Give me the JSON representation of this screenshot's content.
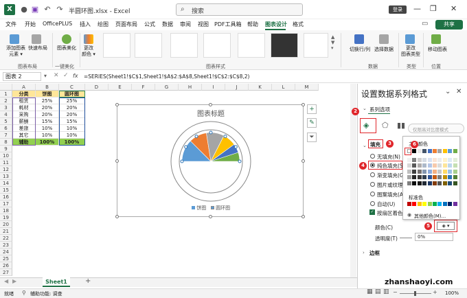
{
  "titlebar": {
    "filename": "半圆环图.xlsx - Excel",
    "search_placeholder": "搜索",
    "login": "登录"
  },
  "menu": {
    "items": [
      "文件",
      "开始",
      "OfficePLUS",
      "插入",
      "绘图",
      "页面布局",
      "公式",
      "数据",
      "审阅",
      "视图",
      "PDF工具箱",
      "帮助",
      "图表设计",
      "格式"
    ],
    "active": "图表设计",
    "share": "共享"
  },
  "ribbon": {
    "add_element": "添加图表\n元素",
    "quick_layout": "快速布局",
    "beautify": "图表美化",
    "change_color": "更改\n颜色",
    "switch_rowcol": "切换行/列",
    "select_data": "选择数据",
    "change_type": "更改\n图表类型",
    "move_chart": "移动图表",
    "groups": [
      "图表布局",
      "一键美化",
      "图表样式",
      "数据",
      "类型",
      "位置"
    ]
  },
  "formula_bar": {
    "name_box": "图表 2",
    "fx": "fx",
    "formula": "=SERIES(Sheet1!$C$1,Sheet1!$A$2:$A$8,Sheet1!$C$2:$C$8,2)"
  },
  "grid": {
    "columns": [
      "A",
      "B",
      "C",
      "D",
      "E",
      "F",
      "G",
      "H",
      "I",
      "J",
      "K",
      "L",
      "M"
    ],
    "rows": [
      "1",
      "2",
      "3",
      "4",
      "5",
      "6",
      "7",
      "8",
      "9",
      "10",
      "11",
      "12",
      "13",
      "14",
      "15",
      "16",
      "17",
      "18",
      "19",
      "20",
      "21",
      "22",
      "23",
      "24",
      "25",
      "26",
      "27"
    ],
    "table": [
      [
        "分类",
        "饼图",
        "圆环图"
      ],
      [
        "租赁",
        "25%",
        "25%"
      ],
      [
        "耗材",
        "20%",
        "20%"
      ],
      [
        "采购",
        "20%",
        "20%"
      ],
      [
        "薪酬",
        "15%",
        "15%"
      ],
      [
        "差旅",
        "10%",
        "10%"
      ],
      [
        "其它",
        "10%",
        "10%"
      ],
      [
        "辅助",
        "100%",
        "100%"
      ]
    ]
  },
  "chart": {
    "title": "图表标题",
    "legend": [
      "饼图",
      "圆环图"
    ],
    "slice_colors": [
      "#5b9bd5",
      "#ed7d31",
      "#a5a5a5",
      "#ffc000",
      "#4472c4",
      "#70ad47"
    ],
    "values": [
      25,
      20,
      20,
      15,
      10,
      10
    ]
  },
  "sheet": {
    "tab": "Sheet1",
    "add": "+"
  },
  "status": {
    "ready": "就绪",
    "accessibility": "辅助功能: 调查",
    "zoom": "100%"
  },
  "pane": {
    "title": "设置数据系列格式",
    "series_options": "系列选项",
    "fill_header": "填充",
    "fill_options": [
      "无填充(N)",
      "纯色填充(S)",
      "渐变填充(G)",
      "图片或纹理填充(P)",
      "图案填充(A)",
      "自动(U)"
    ],
    "vary_colors": "按扇区着色(V)",
    "color_label": "颜色(C)",
    "transparency_label": "透明度(T)",
    "transparency_value": "0%",
    "border_header": "边框",
    "pill_text": "仅限高对比度模式"
  },
  "popup": {
    "theme_label": "主题颜色",
    "standard_label": "标准色",
    "more_colors": "其他颜色(M)..."
  },
  "badges": [
    "2",
    "3",
    "4",
    "5",
    "6"
  ],
  "watermark": "zhanshaoyi.com"
}
